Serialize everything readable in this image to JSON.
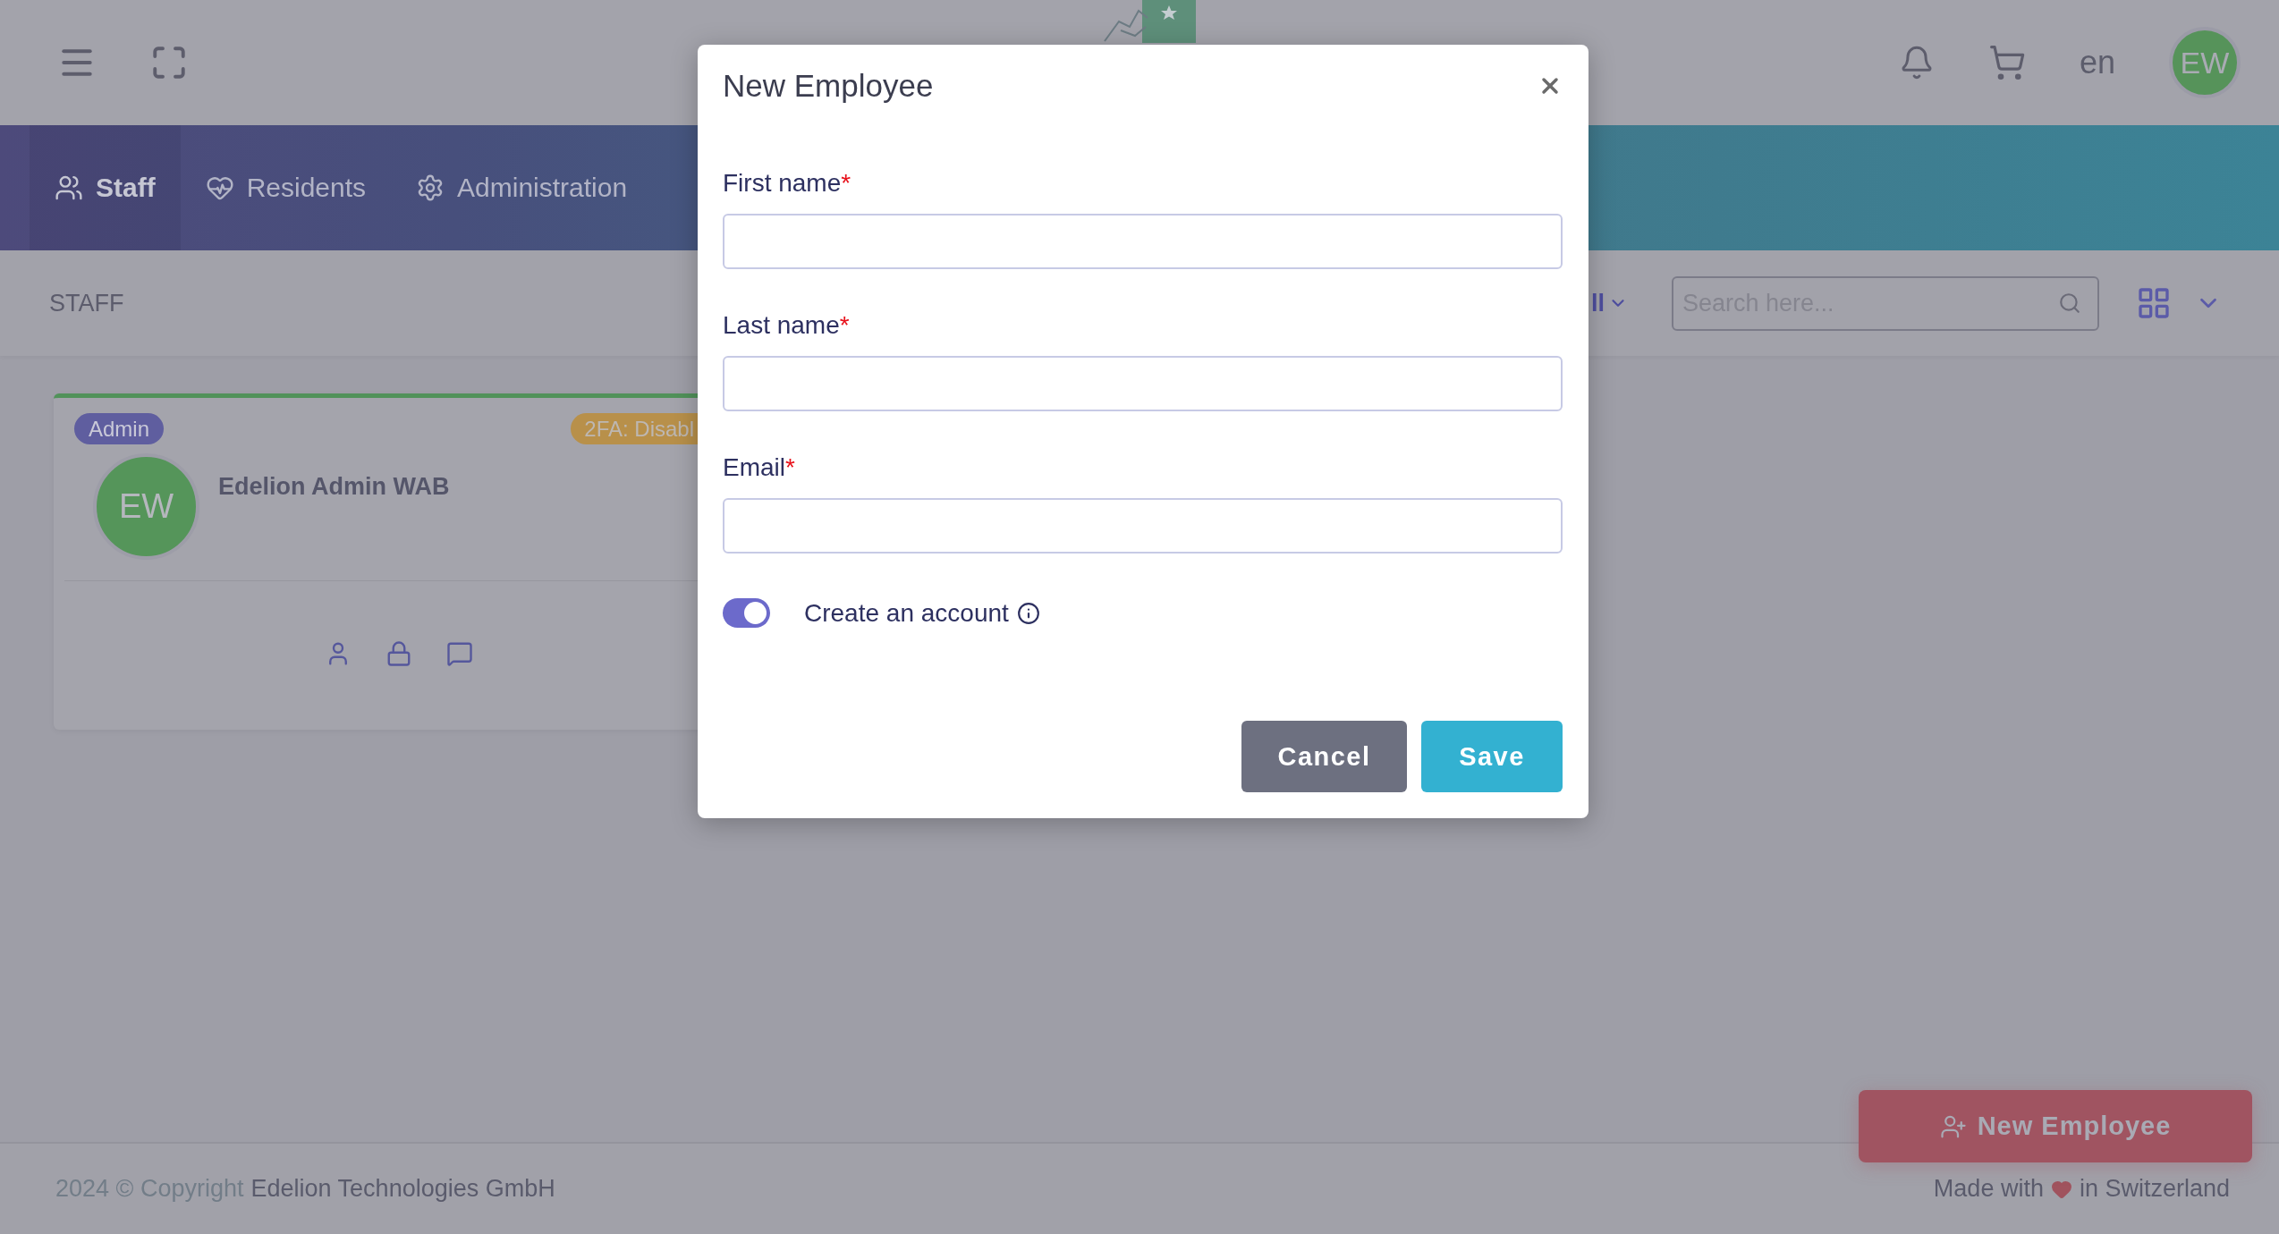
{
  "topbar": {
    "language": "en",
    "avatar": "EW"
  },
  "nav": {
    "tabs": [
      {
        "label": "Staff",
        "selected": true
      },
      {
        "label": "Residents",
        "selected": false
      },
      {
        "label": "Administration",
        "selected": false
      }
    ]
  },
  "toolbar": {
    "title": "STAFF",
    "filter": "ll",
    "search": {
      "placeholder": "Search here..."
    }
  },
  "staff_cards": [
    {
      "role": "Admin",
      "two_factor": "2FA: Disabl",
      "initials": "EW",
      "name": "Edelion Admin WAB"
    }
  ],
  "footer": {
    "copyright": "2024 © Copyright",
    "company": "Edelion Technologies GmbH",
    "made_with": "Made with",
    "location": "in Switzerland"
  },
  "new_employee_button": {
    "label": "New Employee"
  },
  "modal": {
    "title": "New Employee",
    "fields": [
      {
        "label": "First name",
        "required_mark": "*"
      },
      {
        "label": "Last name",
        "required_mark": "*"
      },
      {
        "label": "Email",
        "required_mark": "*"
      }
    ],
    "account_toggle": {
      "label": "Create an account",
      "on": true
    },
    "buttons": [
      {
        "label": "Cancel",
        "kind": "secondary"
      },
      {
        "label": "Save",
        "kind": "primary"
      }
    ]
  }
}
